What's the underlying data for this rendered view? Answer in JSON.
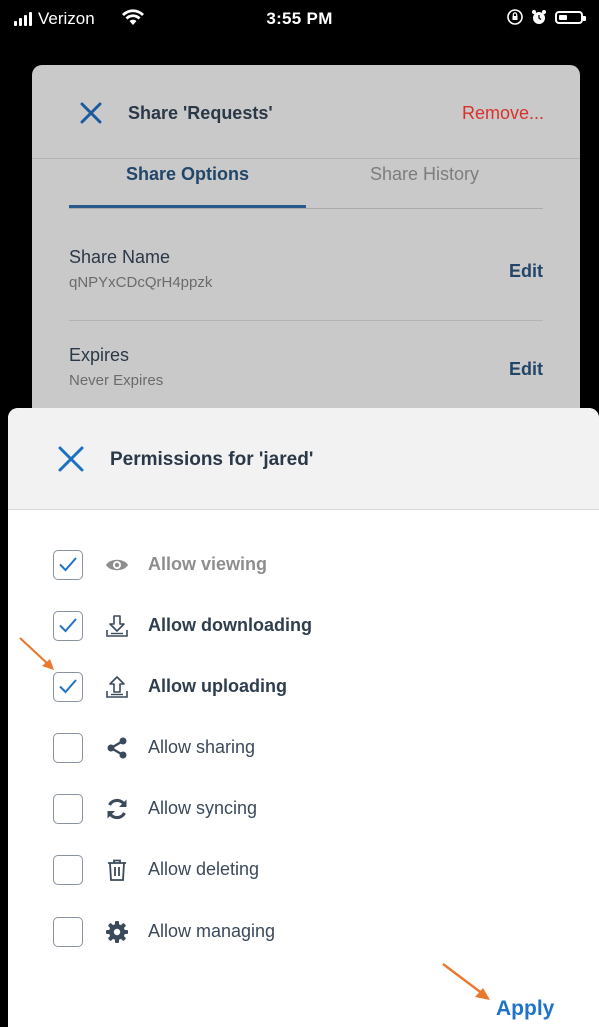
{
  "status_bar": {
    "carrier": "Verizon",
    "time": "3:55 PM"
  },
  "dialog": {
    "title": "Share 'Requests'",
    "remove_label": "Remove...",
    "tabs": [
      "Share Options",
      "Share History"
    ],
    "rows": [
      {
        "label": "Share Name",
        "value": "qNPYxCDcQrH4ppzk",
        "action": "Edit"
      },
      {
        "label": "Expires",
        "value": "Never Expires",
        "action": "Edit"
      }
    ]
  },
  "sheet": {
    "title": "Permissions for 'jared'",
    "permissions": [
      {
        "label": "Allow viewing",
        "checked": true,
        "icon": "eye-icon"
      },
      {
        "label": "Allow downloading",
        "checked": true,
        "icon": "download-icon"
      },
      {
        "label": "Allow uploading",
        "checked": true,
        "icon": "upload-icon"
      },
      {
        "label": "Allow sharing",
        "checked": false,
        "icon": "share-icon"
      },
      {
        "label": "Allow syncing",
        "checked": false,
        "icon": "sync-icon"
      },
      {
        "label": "Allow deleting",
        "checked": false,
        "icon": "trash-icon"
      },
      {
        "label": "Allow managing",
        "checked": false,
        "icon": "gear-icon"
      }
    ],
    "apply_label": "Apply"
  },
  "colors": {
    "accent": "#1f74c9",
    "annotation_arrow": "#e8792e",
    "remove": "#d9312b"
  }
}
